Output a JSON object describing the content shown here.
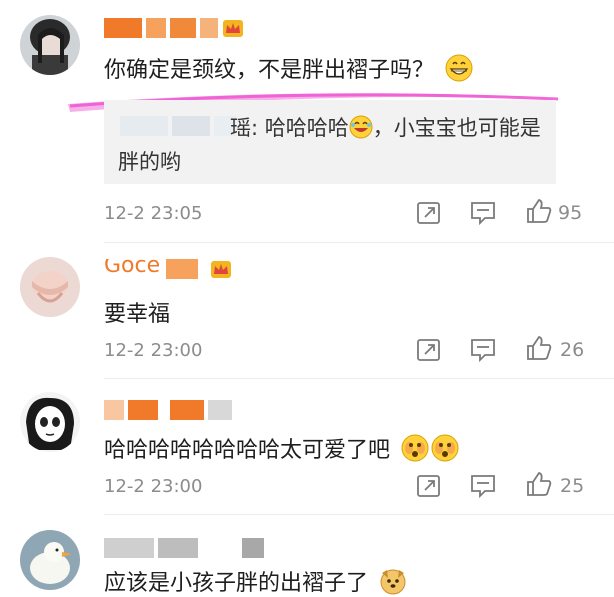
{
  "comments": [
    {
      "text": "你确定是颈纹，不是胖出褶子吗？",
      "emoji": "grin-emoji",
      "reply": {
        "name_fragment": "瑶:",
        "text_line1": "哈哈哈哈",
        "text_line1_after": "，小宝宝也可能是",
        "text_line2": "胖的哟"
      },
      "time": "12-2 23:05",
      "likes": "95"
    },
    {
      "name_fragment": "Goce",
      "text": "要幸福",
      "time": "12-2 23:00",
      "likes": "26"
    },
    {
      "text": "哈哈哈哈哈哈哈哈太可爱了吧",
      "time": "12-2 23:00",
      "likes": "25"
    },
    {
      "text": "应该是小孩子胖的出褶子了"
    }
  ],
  "colors": {
    "name_orange": "#f07a2a",
    "name_orange_light": "#f6a15c",
    "highlight_pink": "#ef6fd8",
    "meta_gray": "#8c8c8c",
    "reply_bg": "#f2f2f2",
    "badge_gold": "#f2b51f",
    "badge_red": "#e0463a"
  },
  "icons": [
    "repost-icon",
    "comment-icon",
    "like-icon",
    "crown-badge-icon",
    "grin-emoji",
    "laugh-emoji",
    "scared-emoji",
    "dog-emoji"
  ]
}
